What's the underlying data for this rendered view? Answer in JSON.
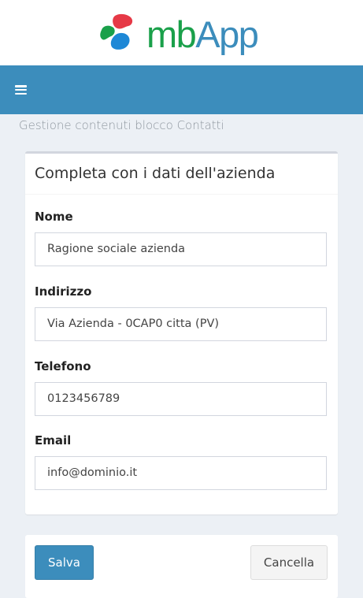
{
  "brand": {
    "logo_text_part1": "mb",
    "logo_text_part2": "App",
    "colors": {
      "green": "#1aa04a",
      "blue": "#3c8dbc",
      "red": "#e63946",
      "navbar": "#3c8dbc"
    }
  },
  "navbar": {
    "menu_icon": "hamburger-menu-icon"
  },
  "page": {
    "subtitle": "Gestione contenuti blocco Contatti"
  },
  "form": {
    "title": "Completa con i dati dell'azienda",
    "fields": [
      {
        "label": "Nome",
        "value": "Ragione sociale azienda"
      },
      {
        "label": "Indirizzo",
        "value": "Via Azienda - 0CAP0 citta (PV)"
      },
      {
        "label": "Telefono",
        "value": "0123456789"
      },
      {
        "label": "Email",
        "value": "info@dominio.it"
      }
    ]
  },
  "actions": {
    "save_label": "Salva",
    "cancel_label": "Cancella"
  }
}
